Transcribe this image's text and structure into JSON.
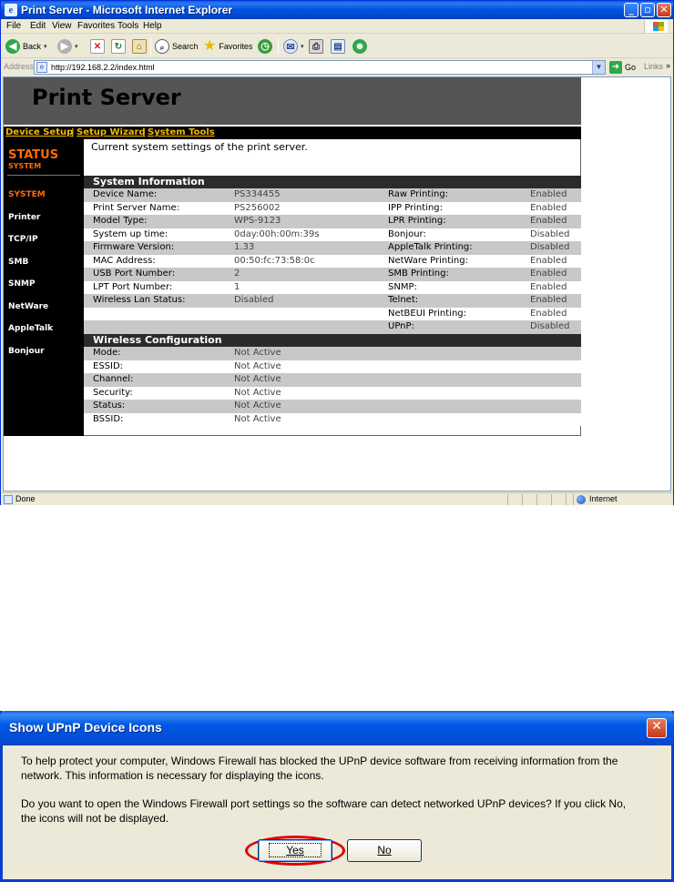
{
  "browser": {
    "title": "Print Server - Microsoft Internet Explorer",
    "menu": [
      "File",
      "Edit",
      "View",
      "Favorites",
      "Tools",
      "Help"
    ],
    "toolbar": {
      "back": "Back",
      "search": "Search",
      "favorites": "Favorites"
    },
    "address": {
      "label": "Address",
      "url": "http://192.168.2.2/index.html",
      "go": "Go",
      "links": "Links"
    },
    "status": {
      "text": "Done",
      "zone": "Internet"
    }
  },
  "page": {
    "title": "Print Server",
    "nav": [
      {
        "label": "Device Setup"
      },
      {
        "label": "Setup Wizard"
      },
      {
        "label": "System Tools"
      }
    ],
    "sidebar": {
      "heading": "STATUS",
      "subheading": "SYSTEM",
      "items": [
        {
          "label": "SYSTEM",
          "active": true
        },
        {
          "label": "Printer"
        },
        {
          "label": "TCP/IP"
        },
        {
          "label": "SMB"
        },
        {
          "label": "SNMP"
        },
        {
          "label": "NetWare"
        },
        {
          "label": "AppleTalk"
        },
        {
          "label": "Bonjour"
        }
      ]
    },
    "intro": "Current system settings of the print server.",
    "system_info": {
      "header": "System Information",
      "rows": [
        {
          "label": "Device Name:",
          "value": "PS334455",
          "label2": "Raw Printing:",
          "value2": "Enabled"
        },
        {
          "label": "Print Server Name:",
          "value": "PS256002",
          "label2": "IPP Printing:",
          "value2": "Enabled"
        },
        {
          "label": "Model Type:",
          "value": "WPS-9123",
          "label2": "LPR Printing:",
          "value2": "Enabled"
        },
        {
          "label": "System up time:",
          "value": "0day:00h:00m:39s",
          "label2": "Bonjour:",
          "value2": "Disabled"
        },
        {
          "label": "Firmware Version:",
          "value": "1.33",
          "label2": "AppleTalk Printing:",
          "value2": "Disabled"
        },
        {
          "label": "MAC Address:",
          "value": "00:50:fc:73:58:0c",
          "label2": "NetWare Printing:",
          "value2": "Enabled"
        },
        {
          "label": "USB Port Number:",
          "value": "2",
          "label2": "SMB Printing:",
          "value2": "Enabled"
        },
        {
          "label": "LPT Port Number:",
          "value": "1",
          "label2": "SNMP:",
          "value2": "Enabled"
        },
        {
          "label": "Wireless Lan Status:",
          "value": "Disabled",
          "label2": "Telnet:",
          "value2": "Enabled"
        },
        {
          "label": "",
          "value": "",
          "label2": "NetBEUI Printing:",
          "value2": "Enabled"
        },
        {
          "label": "",
          "value": "",
          "label2": "UPnP:",
          "value2": "Disabled"
        }
      ]
    },
    "wireless": {
      "header": "Wireless Configuration",
      "rows": [
        {
          "label": "Mode:",
          "value": "Not Active"
        },
        {
          "label": "ESSID:",
          "value": "Not Active"
        },
        {
          "label": "Channel:",
          "value": "Not Active"
        },
        {
          "label": "Security:",
          "value": "Not Active"
        },
        {
          "label": "Status:",
          "value": "Not Active"
        },
        {
          "label": "BSSID:",
          "value": "Not Active"
        }
      ]
    }
  },
  "dialog": {
    "title": "Show UPnP Device Icons",
    "para1_line1": "To help protect your computer, Windows Firewall has blocked the UPnP device software from receiving information from the",
    "para1_line2": "network. This information is necessary for displaying the icons.",
    "para2_line1": "Do you want to open the Windows Firewall port settings so the software can detect networked UPnP devices? If you click No,",
    "para2_line2": "the icons will not be displayed.",
    "yes_label": "Yes",
    "no_label": "No"
  }
}
